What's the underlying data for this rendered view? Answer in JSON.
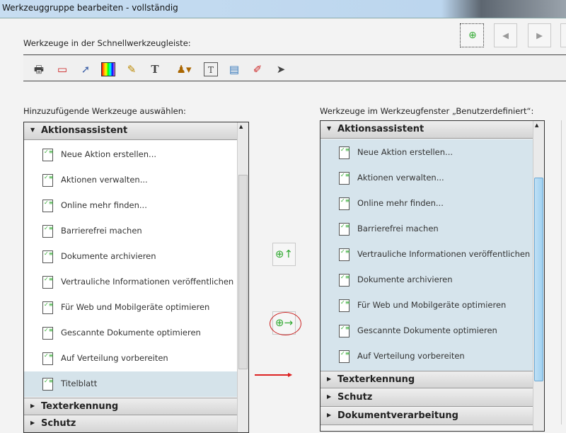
{
  "window": {
    "title": "Werkzeuggruppe bearbeiten - vollständig"
  },
  "quick_toolbar": {
    "label": "Werkzeuge in der Schnellwerkzeugleiste:",
    "icons": [
      "print-zoom-icon",
      "page-marker-icon",
      "select-page-icon",
      "color-icon",
      "highlight-text-icon",
      "text-icon",
      "stamp-icon",
      "textbox-icon",
      "document-edit-icon",
      "sign-icon",
      "pointer-icon"
    ]
  },
  "left": {
    "label": "Hinzuzufügende Werkzeuge auswählen:",
    "group": "Aktionsassistent",
    "items": [
      "Neue Aktion erstellen...",
      "Aktionen verwalten...",
      "Online mehr finden...",
      "Barrierefrei machen",
      "Dokumente archivieren",
      "Vertrauliche Informationen veröffentlichen",
      "Für Web und Mobilgeräte optimieren",
      "Gescannte Dokumente optimieren",
      "Auf Verteilung vorbereiten",
      "Titelblatt"
    ],
    "selected": "Titelblatt",
    "groups": [
      "Texterkennung",
      "Schutz"
    ]
  },
  "right": {
    "label": "Werkzeuge im Werkzeugfenster „Benutzerdefiniert“:",
    "group": "Aktionsassistent",
    "items": [
      "Neue Aktion erstellen...",
      "Aktionen verwalten...",
      "Online mehr finden...",
      "Barrierefrei machen",
      "Vertrauliche Informationen veröffentlichen",
      "Dokumente archivieren",
      "Für Web und Mobilgeräte optimieren",
      "Gescannte Dokumente optimieren",
      "Auf Verteilung vorbereiten"
    ],
    "groups": [
      "Texterkennung",
      "Schutz",
      "Dokumentverarbeitung"
    ]
  },
  "colors": {
    "selected": "#d5e3ea",
    "right_bg": "#d6e4ec",
    "highlight": "#cc2222"
  }
}
